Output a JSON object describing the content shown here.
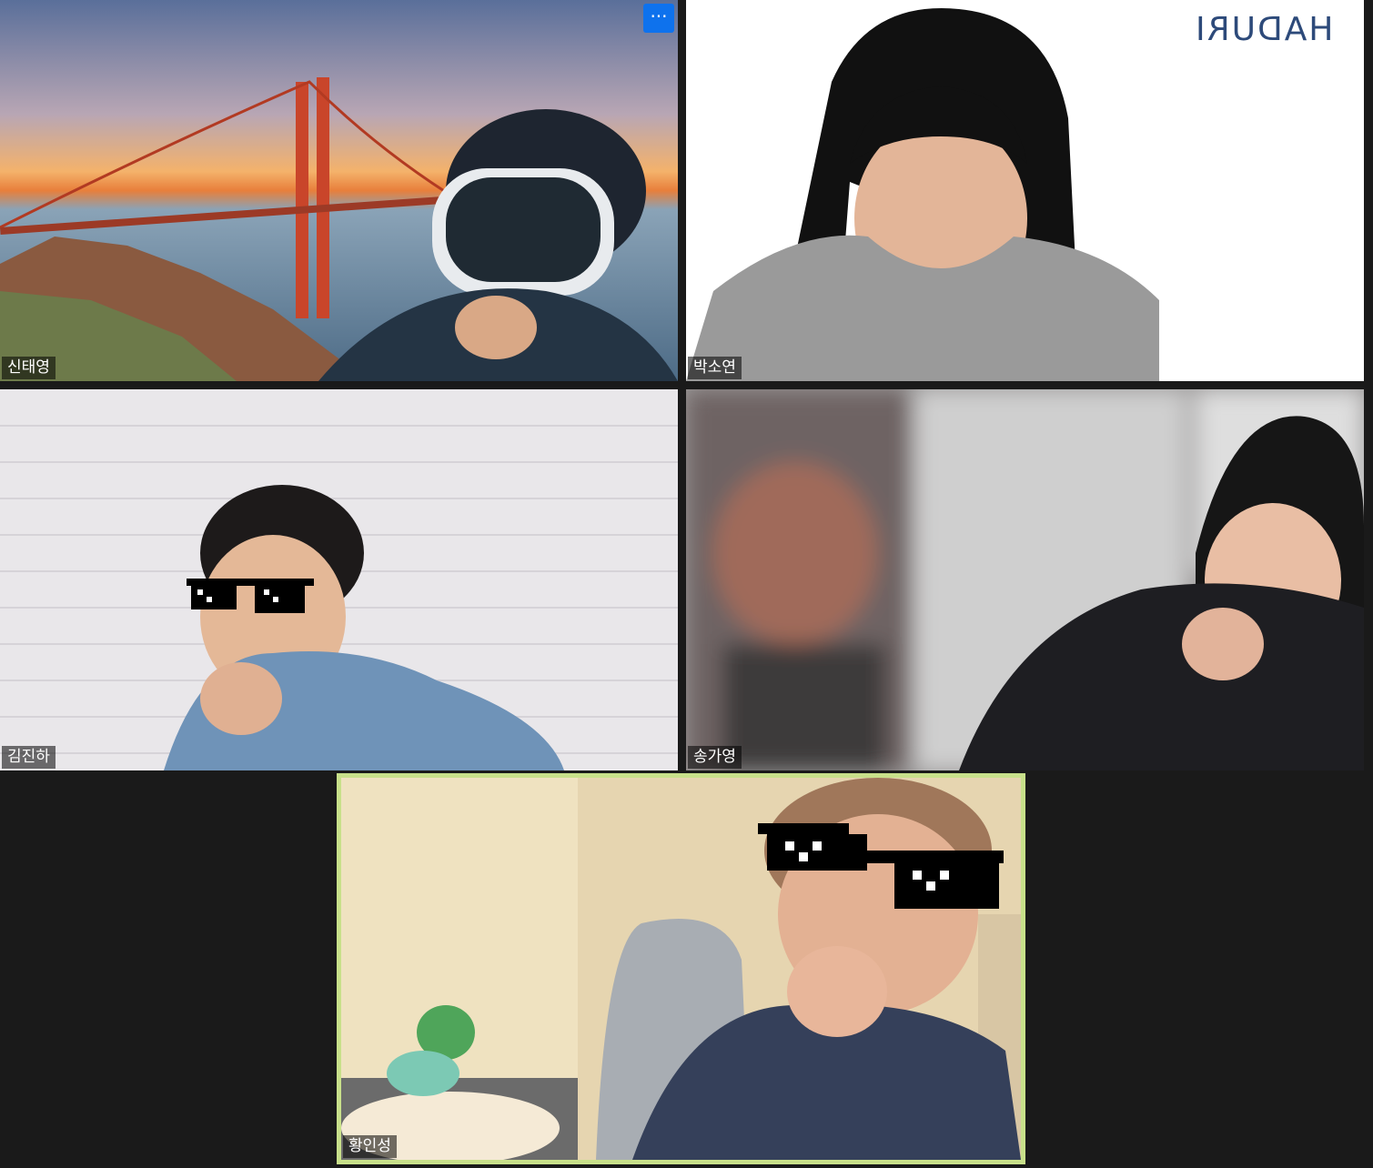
{
  "meeting": {
    "more_options_label": "···",
    "participants": [
      {
        "name": "신태영",
        "background": "golden-gate-bridge-sunset",
        "active_speaker": false
      },
      {
        "name": "박소연",
        "background": "white-wall",
        "logo_text": "HADURI",
        "active_speaker": false
      },
      {
        "name": "김진하",
        "background": "white-brick-wall",
        "filter": "pixel-sunglasses",
        "active_speaker": false
      },
      {
        "name": "송가영",
        "background": "blurred-room",
        "active_speaker": false
      },
      {
        "name": "황인성",
        "background": "bedroom",
        "filter": "pixel-sunglasses",
        "active_speaker": true
      }
    ]
  },
  "colors": {
    "app_background": "#1a1a1a",
    "active_speaker_border": "#c8e08a",
    "more_button": "#0e72ed"
  }
}
